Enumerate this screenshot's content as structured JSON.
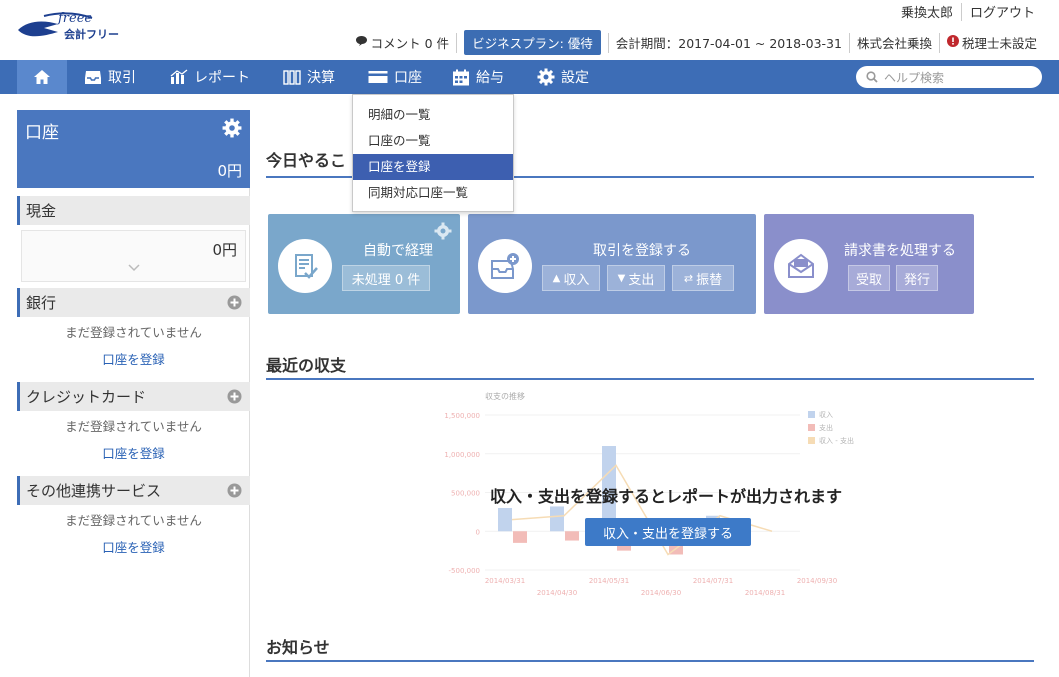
{
  "header": {
    "logo_text": "会計フリー",
    "user_name": "乗換太郎",
    "logout": "ログアウト",
    "comments": "コメント 0 件",
    "plan": "ビジネスプラン: 優待",
    "period": "会計期間：2017-04-01 ~ 2018-03-31",
    "company": "株式会社乗換",
    "tax_accountant": "税理士未設定"
  },
  "nav": {
    "items": [
      {
        "label": "取引",
        "icon": "inbox-icon"
      },
      {
        "label": "レポート",
        "icon": "bar-chart-icon"
      },
      {
        "label": "決算",
        "icon": "books-icon"
      },
      {
        "label": "口座",
        "icon": "card-icon"
      },
      {
        "label": "給与",
        "icon": "calendar-icon"
      },
      {
        "label": "設定",
        "icon": "gear-icon"
      }
    ],
    "search_placeholder": "ヘルプ検索"
  },
  "dropdown": {
    "items": [
      "明細の一覧",
      "口座の一覧",
      "口座を登録",
      "同期対応口座一覧"
    ],
    "active_index": 2
  },
  "sidebar": {
    "title": "口座",
    "total": "0円",
    "cash": {
      "label": "現金",
      "amount": "0円"
    },
    "sections": [
      {
        "label": "銀行",
        "note": "まだ登録されていません",
        "link": "口座を登録"
      },
      {
        "label": "クレジットカード",
        "note": "まだ登録されていません",
        "link": "口座を登録"
      },
      {
        "label": "その他連携サービス",
        "note": "まだ登録されていません",
        "link": "口座を登録"
      }
    ]
  },
  "main": {
    "todo_title": "今日やるこ",
    "cards": {
      "auto": {
        "title": "自動で経理",
        "button": "未処理 0 件"
      },
      "register": {
        "title": "取引を登録する",
        "income": "収入",
        "expense": "支出",
        "transfer": "振替"
      },
      "invoice": {
        "title": "請求書を処理する",
        "receive": "受取",
        "issue": "発行"
      }
    },
    "recent_title": "最近の収支",
    "empty_message": "収入・支出を登録するとレポートが出力されます",
    "register_button": "収入・支出を登録する",
    "news_title": "お知らせ"
  },
  "chart_data": {
    "type": "bar",
    "title": "収支の推移",
    "y_ticks": [
      "1,500,000",
      "1,000,000",
      "500,000",
      "0",
      "-500,000"
    ],
    "x_ticks": [
      "2014/03/31",
      "2014/04/30",
      "2014/05/31",
      "2014/06/30",
      "2014/07/31",
      "2014/08/31",
      "2014/09/30"
    ],
    "legend": [
      "収入",
      "支出",
      "収入 - 支出"
    ],
    "series": [
      {
        "name": "収入",
        "values": [
          300000,
          320000,
          1100000,
          0,
          200000,
          0
        ]
      },
      {
        "name": "支出",
        "values": [
          -150000,
          -120000,
          -250000,
          -300000,
          0,
          0
        ]
      }
    ],
    "colors": {
      "income": "#8fb0e0",
      "expense": "#e8867f",
      "net": "#f0c07a"
    }
  }
}
